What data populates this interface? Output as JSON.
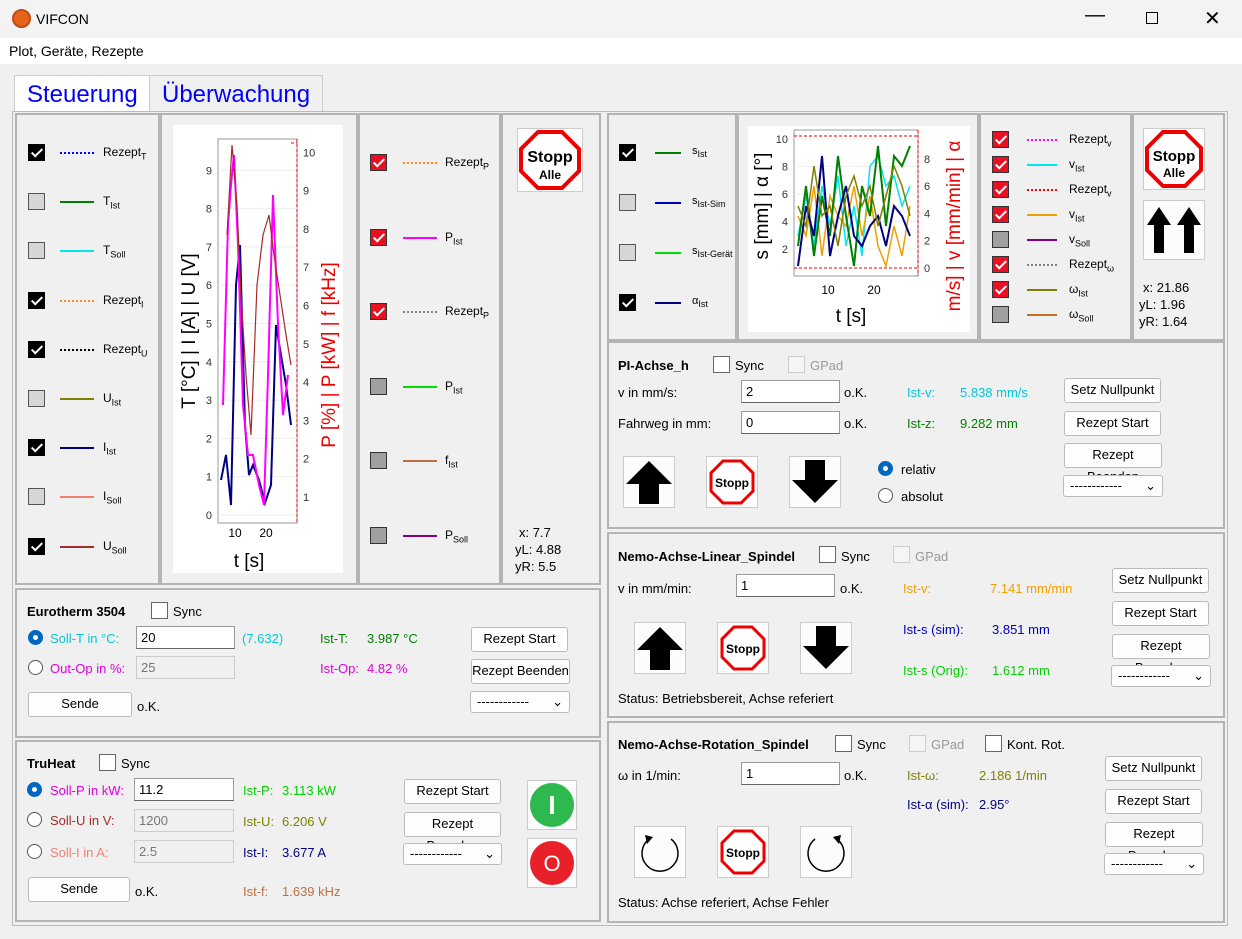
{
  "window": {
    "title": "VIFCON",
    "menu": "Plot, Geräte, Rezepte"
  },
  "tabs": [
    "Steuerung",
    "Überwachung"
  ],
  "left_legend": [
    {
      "base": "Rezept",
      "sub": "T",
      "checked": true,
      "color": "#0000ff",
      "style": "dot"
    },
    {
      "base": "T",
      "sub": "Ist",
      "checked": false,
      "color": "#008000",
      "style": "solid"
    },
    {
      "base": "T",
      "sub": "Soll",
      "checked": false,
      "color": "#00e5ee",
      "style": "solid"
    },
    {
      "base": "Rezept",
      "sub": "I",
      "checked": true,
      "color": "#ff8c1a",
      "style": "dot"
    },
    {
      "base": "Rezept",
      "sub": "U",
      "checked": true,
      "color": "#000000",
      "style": "dot"
    },
    {
      "base": "U",
      "sub": "Ist",
      "checked": false,
      "color": "#808000",
      "style": "solid"
    },
    {
      "base": "I",
      "sub": "Ist",
      "checked": true,
      "color": "#000080",
      "style": "solid"
    },
    {
      "base": "I",
      "sub": "Soll",
      "checked": false,
      "color": "#f08070",
      "style": "solid"
    },
    {
      "base": "U",
      "sub": "Soll",
      "checked": true,
      "color": "#a52a2a",
      "style": "solid"
    }
  ],
  "left_chart": {
    "ylabel_left": "T [°C] | I [A] | U [V]",
    "ylabel_right": "P [%] | P [kW] | f [kHz]",
    "xlabel": "t [s]",
    "yticks_left": [
      "0",
      "1",
      "2",
      "3",
      "4",
      "5",
      "6",
      "7",
      "8",
      "9"
    ],
    "yticks_right": [
      "1",
      "2",
      "3",
      "4",
      "5",
      "6",
      "7",
      "8",
      "9",
      "10"
    ],
    "xticks": [
      "10",
      "20"
    ],
    "legend_right": [
      {
        "base": "Rezept",
        "sub": "P",
        "checked": true,
        "color": "#ff8c1a",
        "style": "dot"
      },
      {
        "base": "P",
        "sub": "Ist",
        "checked": true,
        "color": "#ff00ff",
        "style": "solid"
      },
      {
        "base": "Rezept",
        "sub": "P",
        "checked": true,
        "color": "#808080",
        "style": "dot"
      },
      {
        "base": "P",
        "sub": "Ist",
        "checked": false,
        "color": "#00e000",
        "style": "solid"
      },
      {
        "base": "f",
        "sub": "Ist",
        "checked": false,
        "color": "#c07040",
        "style": "solid"
      },
      {
        "base": "P",
        "sub": "Soll",
        "checked": false,
        "color": "#800080",
        "style": "solid"
      }
    ]
  },
  "left_stop": {
    "line1": "Stopp",
    "line2": "Alle",
    "x": "x:  7.7",
    "yL": "yL: 4.88",
    "yR": "yR: 5.5"
  },
  "right_legend_left": [
    {
      "base": "s",
      "sub": "Ist",
      "checked": true,
      "color": "#008000"
    },
    {
      "base": "s",
      "sub": "Ist-Sim",
      "checked": false,
      "color": "#0000c0"
    },
    {
      "base": "s",
      "sub": "Ist-Gerät",
      "checked": false,
      "color": "#00e000"
    },
    {
      "base": "α",
      "sub": "Ist",
      "checked": true,
      "color": "#000080"
    }
  ],
  "right_chart": {
    "ylabel_left": "s [mm] | α [°]",
    "ylabel_right": "m/s] | v [mm/min] | α",
    "xlabel": "t [s]",
    "yticks_left": [
      "2",
      "4",
      "6",
      "8",
      "10"
    ],
    "yticks_right": [
      "0",
      "2",
      "4",
      "6",
      "8"
    ],
    "xticks": [
      "10",
      "20"
    ]
  },
  "right_legend_right": [
    {
      "base": "Rezept",
      "sub": "v",
      "checked": true,
      "color": "#ff00ff",
      "style": "dot"
    },
    {
      "base": "v",
      "sub": "Ist",
      "checked": true,
      "color": "#00e5ee",
      "style": "solid"
    },
    {
      "base": "Rezept",
      "sub": "v",
      "checked": true,
      "color": "#ff0000",
      "style": "dot"
    },
    {
      "base": "v",
      "sub": "Ist",
      "checked": true,
      "color": "#f0a000",
      "style": "solid"
    },
    {
      "base": "v",
      "sub": "Soll",
      "checked": false,
      "color": "#800080",
      "style": "solid"
    },
    {
      "base": "Rezept",
      "sub": "ω",
      "checked": true,
      "color": "#808080",
      "style": "dot"
    },
    {
      "base": "ω",
      "sub": "Ist",
      "checked": true,
      "color": "#808000",
      "style": "solid"
    },
    {
      "base": "ω",
      "sub": "Soll",
      "checked": false,
      "color": "#c07020",
      "style": "solid"
    }
  ],
  "right_stop": {
    "line1": "Stopp",
    "line2": "Alle",
    "x": "x:  21.86",
    "yL": "yL: 1.96",
    "yR": "yR: 1.64"
  },
  "eurotherm": {
    "title": "Eurotherm 3504",
    "sync": "Sync",
    "soll_label": "Soll-T in °C:",
    "soll_value": "20",
    "soll_extra": "(7.632)",
    "out_label": "Out-Op in %:",
    "out_value": "25",
    "ist_t_label": "Ist-T:",
    "ist_t": "3.987 °C",
    "ist_op_label": "Ist-Op:",
    "ist_op": "4.82 %",
    "rezept_start": "Rezept Start",
    "rezept_end": "Rezept Beenden",
    "dropdown": "------------",
    "send": "Sende",
    "ok": "o.K."
  },
  "truheat": {
    "title": "TruHeat",
    "sync": "Sync",
    "p_label": "Soll-P in kW:",
    "p_value": "11.2",
    "u_label": "Soll-U in V:",
    "u_value": "1200",
    "i_label": "Soll-I in A:",
    "i_value": "2.5",
    "ist_p_label": "Ist-P:",
    "ist_p": "3.113 kW",
    "ist_u_label": "Ist-U:",
    "ist_u": "6.206 V",
    "ist_i_label": "Ist-I:",
    "ist_i": "3.677 A",
    "ist_f_label": "Ist-f:",
    "ist_f": "1.639 kHz",
    "rezept_start": "Rezept Start",
    "rezept_end": "Rezept Beenden",
    "dropdown": "------------",
    "send": "Sende",
    "ok": "o.K.",
    "on_symbol": "I",
    "off_symbol": "O"
  },
  "pi": {
    "title": "PI-Achse_h",
    "sync": "Sync",
    "gpad": "GPad",
    "v_label": "v in mm/s:",
    "v_value": "2",
    "f_label": "Fahrweg in mm:",
    "f_value": "0",
    "ok1": "o.K.",
    "ok2": "o.K.",
    "istv_label": "Ist-v:",
    "istv": "5.838 mm/s",
    "istz_label": "Ist-z:",
    "istz": "9.282 mm",
    "null": "Setz Nullpunkt",
    "rezept_start": "Rezept Start",
    "rezept_end": "Rezept Beenden",
    "dropdown": "------------",
    "relativ": "relativ",
    "absolut": "absolut",
    "stopp": "Stopp"
  },
  "nemo_lin": {
    "title": "Nemo-Achse-Linear_Spindel",
    "sync": "Sync",
    "gpad": "GPad",
    "v_label": "v in mm/min:",
    "v_value": "1",
    "ok": "o.K.",
    "istv_label": "Ist-v:",
    "istv": "7.141 mm/min",
    "iss_label": "Ist-s (sim):",
    "iss": "3.851 mm",
    "iso_label": "Ist-s (Orig):",
    "iso": "1.612 mm",
    "null": "Setz Nullpunkt",
    "rezept_start": "Rezept Start",
    "rezept_end": "Rezept Beenden",
    "dropdown": "------------",
    "status": "Status: Betriebsbereit, Achse referiert",
    "stopp": "Stopp"
  },
  "nemo_rot": {
    "title": "Nemo-Achse-Rotation_Spindel",
    "sync": "Sync",
    "gpad": "GPad",
    "kont": "Kont. Rot.",
    "w_label": "ω in 1/min:",
    "w_value": "1",
    "ok": "o.K.",
    "istw_label": "Ist-ω:",
    "istw": "2.186 1/min",
    "ista_label": "Ist-α (sim):",
    "ista": "2.95°",
    "null": "Setz Nullpunkt",
    "rezept_start": "Rezept Start",
    "rezept_end": "Rezept Beenden",
    "dropdown": "------------",
    "status": "Status: Achse referiert, Achse Fehler",
    "stopp": "Stopp"
  }
}
